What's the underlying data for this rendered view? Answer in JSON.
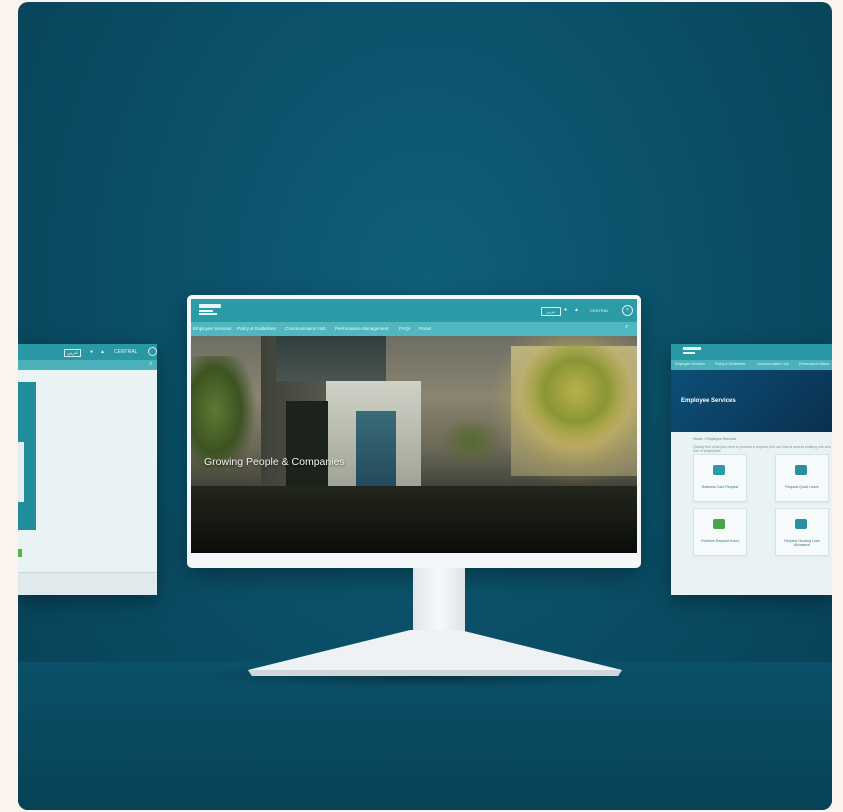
{
  "main_screen": {
    "topbar": {
      "lang_button": "عربي",
      "contact_text": "CENTRAL"
    },
    "nav_items": [
      "Employee Services",
      "Policy & Guidelines",
      "Communication Hub",
      "Performance Management",
      "FAQs",
      "Portal"
    ],
    "hero_tagline": "Growing People & Companies"
  },
  "left_screen": {
    "lang_button": "عربي",
    "contact_text": "CENTRAL"
  },
  "right_screen": {
    "nav_items": [
      "Employee Services",
      "Policy & Guidelines",
      "Communication Hub",
      "Performance Mana"
    ],
    "hero_title": "Employee Services",
    "breadcrumb": "Home > Employee Services",
    "description": "Quickly find what you need to process a request, find out how to access existing one and one of employees",
    "cards": [
      {
        "label": "Business Card Request",
        "icon": "id-card-icon",
        "color": "#2a9aa6"
      },
      {
        "label": "Request Quick Leave",
        "icon": "clipboard-icon",
        "color": "#2a8fa0"
      },
      {
        "label": "Overtime Request Hours",
        "icon": "money-hand-icon",
        "color": "#4aa34a"
      },
      {
        "label": "Request Housing Loan Allowance",
        "icon": "home-money-icon",
        "color": "#2a8fa0"
      }
    ]
  }
}
